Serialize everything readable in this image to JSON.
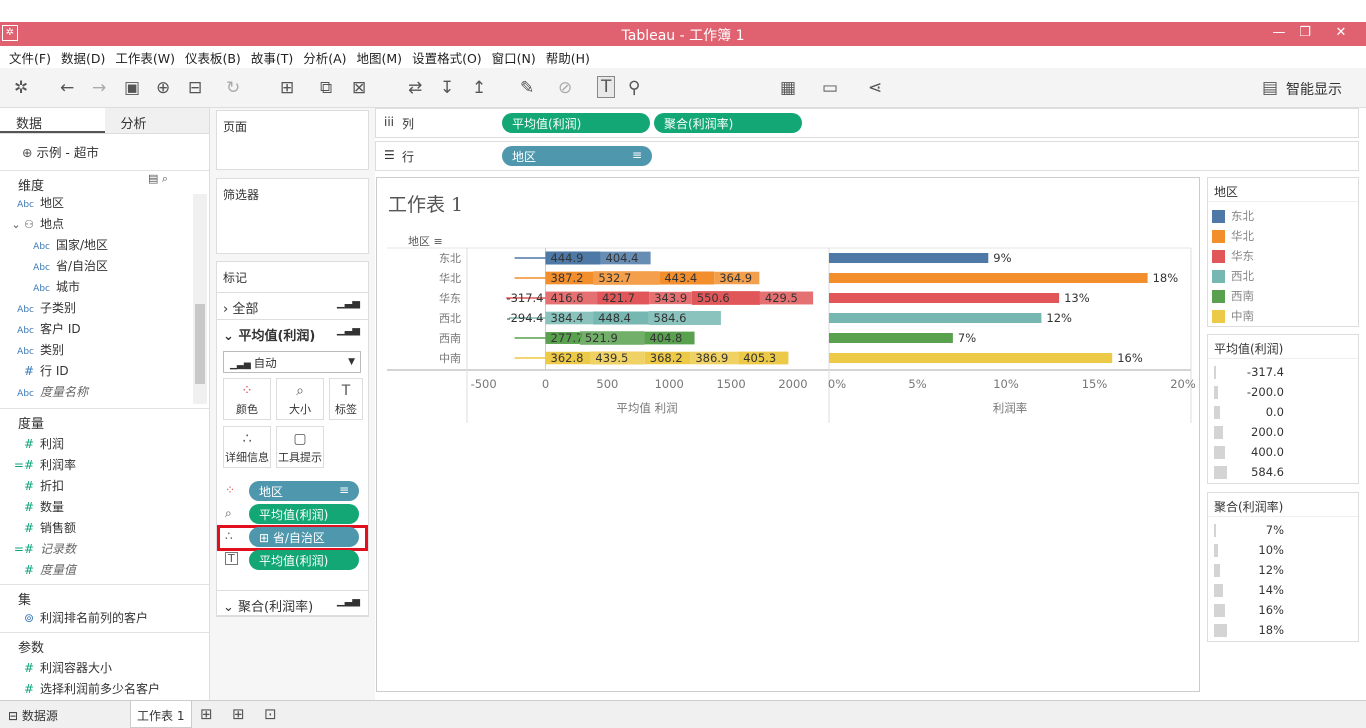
{
  "app": {
    "title": "Tableau - 工作簿 1"
  },
  "menu": [
    "文件(F)",
    "数据(D)",
    "工作表(W)",
    "仪表板(B)",
    "故事(T)",
    "分析(A)",
    "地图(M)",
    "设置格式(O)",
    "窗口(N)",
    "帮助(H)"
  ],
  "toolbar": {
    "fit_select": "标准",
    "show_me": "智能显示"
  },
  "left_pane": {
    "tabs": [
      "数据",
      "分析"
    ],
    "datasource": "示例 - 超市",
    "dimensions_header": "维度",
    "dimensions": [
      "地区",
      "地点",
      "国家/地区",
      "省/自治区",
      "城市",
      "子类别",
      "客户 ID",
      "类别",
      "行 ID",
      "度量名称"
    ],
    "measures_header": "度量",
    "measures": [
      "利润",
      "利润率",
      "折扣",
      "数量",
      "销售额",
      "记录数",
      "度量值"
    ],
    "sets_header": "集",
    "sets": [
      "利润排名前列的客户"
    ],
    "params_header": "参数",
    "params": [
      "利润容器大小",
      "选择利润前多少名客户"
    ]
  },
  "middle_pane": {
    "pages": "页面",
    "filters": "筛选器",
    "marks": "标记",
    "all": "全部",
    "avg_profit": "平均值(利润)",
    "mark_type": "自动",
    "buttons": [
      "颜色",
      "大小",
      "标签",
      "详细信息",
      "工具提示"
    ],
    "mark_pills": [
      "地区",
      "平均值(利润)",
      "省/自治区",
      "平均值(利润)"
    ],
    "agg_margin": "聚合(利润率)"
  },
  "shelves": {
    "columns_label": "列",
    "rows_label": "行",
    "columns": [
      "平均值(利润)",
      "聚合(利润率)"
    ],
    "rows": [
      "地区"
    ]
  },
  "sheet": {
    "title": "工作表 1",
    "row_header": "地区"
  },
  "chart_data": [
    {
      "type": "bar",
      "xlabel": "平均值 利润",
      "xlim": [
        -500,
        2000
      ],
      "x_ticks": [
        "-500",
        "0",
        "500",
        "1000",
        "1500",
        "2000"
      ],
      "categories": [
        "东北",
        "华北",
        "华东",
        "西北",
        "西南",
        "中南"
      ],
      "segments": [
        [
          444.9,
          404.4
        ],
        [
          387.2,
          532.7,
          443.4,
          364.9
        ],
        [
          -317.4,
          416.6,
          421.7,
          343.9,
          550.6,
          429.5
        ],
        [
          -294.4,
          384.4,
          448.4,
          584.6
        ],
        [
          277.7,
          521.9,
          404.8
        ],
        [
          362.8,
          439.5,
          368.2,
          386.9,
          405.3
        ]
      ]
    },
    {
      "type": "bar",
      "xlabel": "利润率",
      "xlim": [
        0,
        20
      ],
      "x_ticks": [
        "0%",
        "5%",
        "10%",
        "15%",
        "20%"
      ],
      "categories": [
        "东北",
        "华北",
        "华东",
        "西北",
        "西南",
        "中南"
      ],
      "values": [
        9,
        18,
        13,
        12,
        7,
        16
      ],
      "labels": [
        "9%",
        "18%",
        "13%",
        "12%",
        "7%",
        "16%"
      ]
    }
  ],
  "colors": {
    "东北": "#4e79a7",
    "华北": "#f28e2b",
    "华东": "#e15759",
    "西北": "#76b7b2",
    "西南": "#59a14f",
    "中南": "#edc948"
  },
  "legends": {
    "color": {
      "title": "地区",
      "items": [
        "东北",
        "华北",
        "华东",
        "西北",
        "西南",
        "中南"
      ]
    },
    "size_profit": {
      "title": "平均值(利润)",
      "items": [
        "-317.4",
        "-200.0",
        "0.0",
        "200.0",
        "400.0",
        "584.6"
      ]
    },
    "size_margin": {
      "title": "聚合(利润率)",
      "items": [
        "7%",
        "10%",
        "12%",
        "14%",
        "16%",
        "18%"
      ]
    }
  },
  "statusbar": {
    "datasource": "数据源",
    "sheet_tab": "工作表 1"
  }
}
